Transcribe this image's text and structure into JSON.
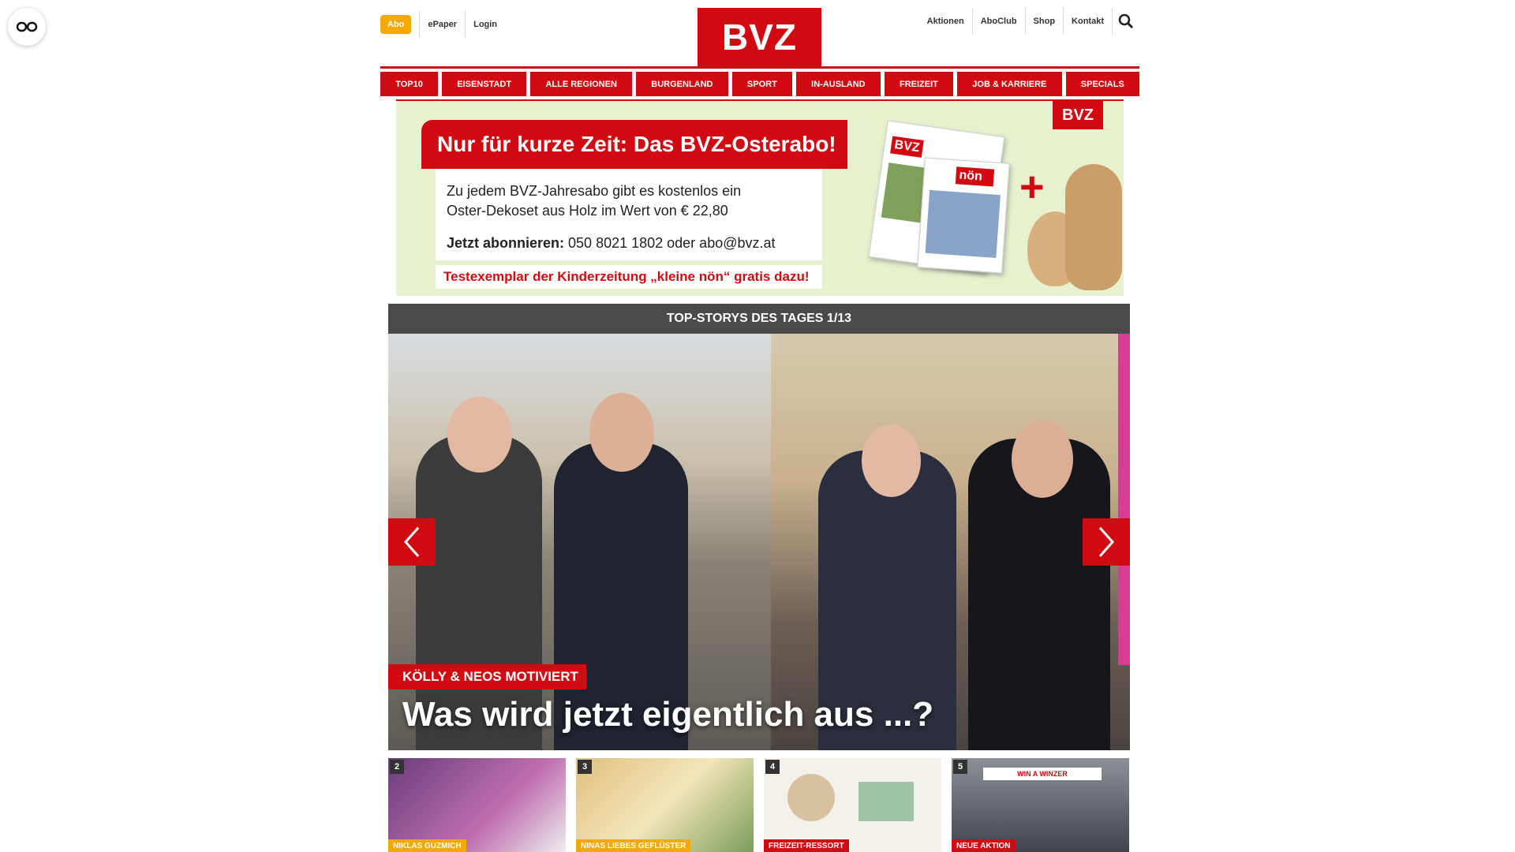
{
  "header": {
    "abo_label": "Abo",
    "epaper_label": "ePaper",
    "login_label": "Login",
    "logo_text": "BVZ",
    "right_links": [
      "Aktionen",
      "AboClub",
      "Shop",
      "Kontakt"
    ]
  },
  "nav": {
    "items": [
      "TOP10",
      "EISENSTADT",
      "ALLE REGIONEN",
      "BURGENLAND",
      "SPORT",
      "IN-AUSLAND",
      "FREIZEIT",
      "JOB & KARRIERE",
      "SPECIALS"
    ]
  },
  "ad": {
    "headline": "Nur für kurze Zeit: Das BVZ-Osterabo!",
    "line1": "Zu jedem BVZ-Jahresabo gibt es kostenlos ein",
    "line2": "Oster-Dekoset aus Holz im Wert von € 22,80",
    "cta_bold": "Jetzt abonnieren:",
    "cta_rest": " 050 8021 1802 oder abo@bvz.at",
    "footer": "Testexemplar der Kinderzeitung „kleine nön“ gratis dazu!",
    "logo": "BVZ",
    "mag_logo": "BVZ",
    "kids_logo": "nön",
    "plus": "+"
  },
  "stories": {
    "header": "TOP-STORYS DES TAGES 1/13",
    "kicker": "KÖLLY & NEOS MOTIVIERT",
    "headline": "Was wird jetzt eigentlich aus ...?",
    "thumbs": [
      {
        "num": "2",
        "tag": "NIKLAS GUZMICH"
      },
      {
        "num": "3",
        "tag": "NINAS LIEBES GEFLÜSTER"
      },
      {
        "num": "4",
        "tag": "FREIZEIT-RESSORT"
      },
      {
        "num": "5",
        "tag": "NEUE AKTION"
      }
    ],
    "thumb5_banner": "WIN A WINZER"
  },
  "colors": {
    "brand_red": "#d10a11",
    "abo_orange": "#f5a800",
    "stories_header": "#4a4a4a",
    "ad_background": "#e7f0cf"
  }
}
